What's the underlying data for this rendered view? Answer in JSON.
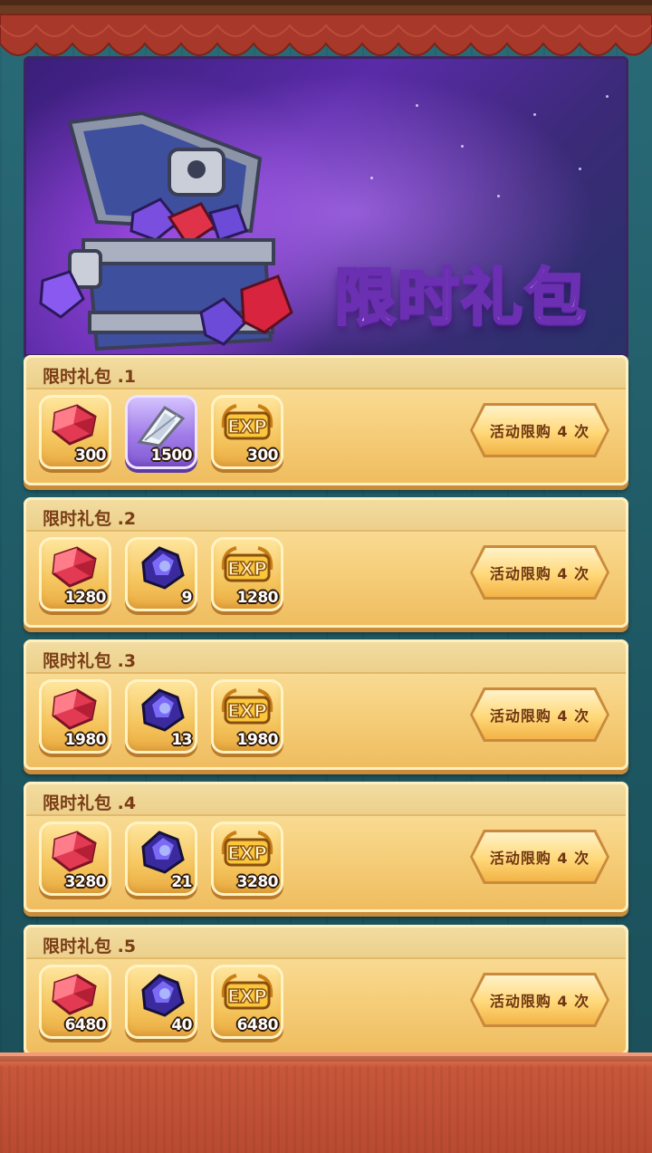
{
  "banner": {
    "title": "限时礼包"
  },
  "packs": [
    {
      "title": "限时礼包 .1",
      "button": "活动限购 4 次",
      "items": [
        {
          "icon": "ruby-gem-icon",
          "count": "300"
        },
        {
          "icon": "arrow-upgrade-icon",
          "count": "1500"
        },
        {
          "icon": "exp-icon",
          "count": "300"
        }
      ]
    },
    {
      "title": "限时礼包 .2",
      "button": "活动限购 4 次",
      "items": [
        {
          "icon": "ruby-gem-icon",
          "count": "1280"
        },
        {
          "icon": "sapphire-crystal-icon",
          "count": "9"
        },
        {
          "icon": "exp-icon",
          "count": "1280"
        }
      ]
    },
    {
      "title": "限时礼包 .3",
      "button": "活动限购 4 次",
      "items": [
        {
          "icon": "ruby-gem-icon",
          "count": "1980"
        },
        {
          "icon": "sapphire-crystal-icon",
          "count": "13"
        },
        {
          "icon": "exp-icon",
          "count": "1980"
        }
      ]
    },
    {
      "title": "限时礼包 .4",
      "button": "活动限购 4 次",
      "items": [
        {
          "icon": "ruby-gem-icon",
          "count": "3280"
        },
        {
          "icon": "sapphire-crystal-icon",
          "count": "21"
        },
        {
          "icon": "exp-icon",
          "count": "3280"
        }
      ]
    },
    {
      "title": "限时礼包 .5",
      "button": "活动限购 4 次",
      "items": [
        {
          "icon": "ruby-gem-icon",
          "count": "6480"
        },
        {
          "icon": "sapphire-crystal-icon",
          "count": "40"
        },
        {
          "icon": "exp-icon",
          "count": "6480"
        }
      ]
    }
  ],
  "colors": {
    "card": "#f6cf7c",
    "title_text": "#7a3d16",
    "banner_purple": "#5a2ba8",
    "curtain_red": "#a8392a"
  }
}
